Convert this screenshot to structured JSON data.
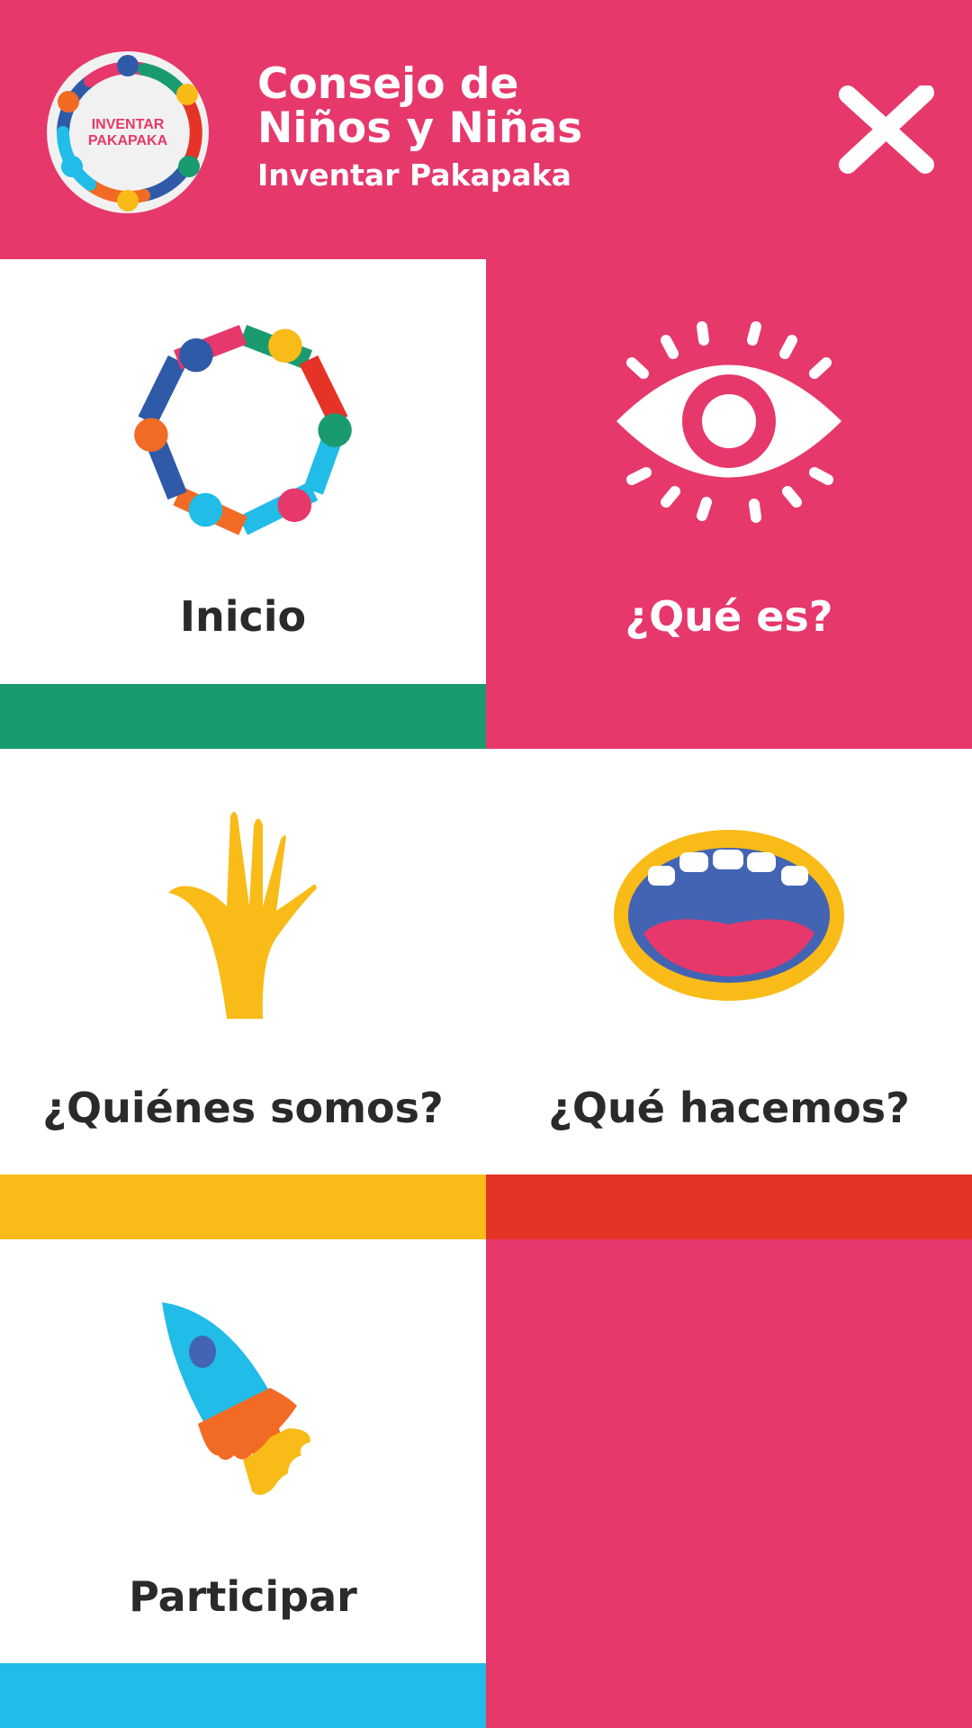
{
  "header": {
    "logo_text_line1": "INVENTAR",
    "logo_text_line2": "PAKAPAKA",
    "title_line1": "Consejo de",
    "title_line2": "Niños y Niñas",
    "subtitle": "Inventar Pakapaka",
    "close_icon": "close-icon"
  },
  "menu": [
    {
      "label": "Inicio",
      "icon": "children-ring-icon",
      "bar_color": "#1a9b6f",
      "bg": "#ffffff"
    },
    {
      "label": "¿Qué es?",
      "icon": "eye-icon",
      "bar_color": "#e6386b",
      "bg": "#e6386b"
    },
    {
      "label": "¿Quiénes somos?",
      "icon": "hand-icon",
      "bar_color": "#f8bb18",
      "bg": "#ffffff"
    },
    {
      "label": "¿Qué hacemos?",
      "icon": "mouth-icon",
      "bar_color": "#e63327",
      "bg": "#ffffff"
    },
    {
      "label": "Participar",
      "icon": "rocket-icon",
      "bar_color": "#21bce8",
      "bg": "#ffffff"
    }
  ],
  "colors": {
    "brand_pink": "#e6386b",
    "green": "#1a9b6f",
    "yellow": "#f8bb18",
    "red": "#e63327",
    "cyan": "#21bce8"
  }
}
